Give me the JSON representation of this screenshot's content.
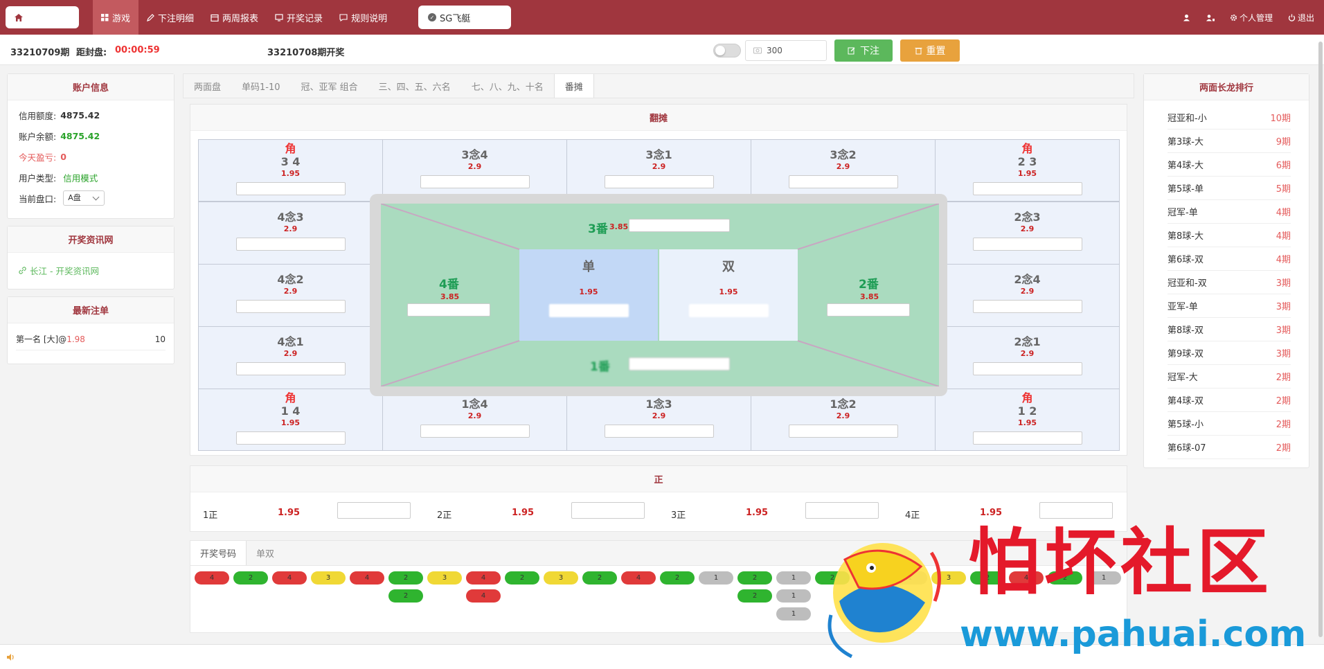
{
  "topbar": {
    "nav": [
      "游戏",
      "下注明细",
      "两周报表",
      "开奖记录",
      "规则说明"
    ],
    "active_game": "SG飞艇",
    "right": [
      "个人管理",
      "退出"
    ]
  },
  "subbar": {
    "period": "33210709期",
    "close_label": "距封盘:",
    "close_time": "00:00:59",
    "last_draw": "33210708期开奖",
    "amount": "300",
    "bet_button": "下注",
    "reset_button": "重置"
  },
  "account": {
    "title": "账户信息",
    "credit_label": "信用额度:",
    "credit_value": "4875.42",
    "balance_label": "账户余额:",
    "balance_value": "4875.42",
    "profit_label": "今天盈亏:",
    "profit_value": "0",
    "type_label": "用户类型:",
    "type_value": "信用模式",
    "market_label": "当前盘口:",
    "market_value": "A盘"
  },
  "info": {
    "title": "开奖资讯网",
    "link": "长江 - 开奖资讯网"
  },
  "recent": {
    "title": "最新注单",
    "bet": "第一名 [大]@",
    "odds": "1.98",
    "amount": "10"
  },
  "tabs": [
    "两面盘",
    "单码1-10",
    "冠、亚军 组合",
    "三、四、五、六名",
    "七、八、九、十名",
    "番摊"
  ],
  "fantan": {
    "title": "翻摊",
    "jiao": "角",
    "corner_tl": "3 4",
    "corner_tr": "2 3",
    "corner_bl": "1 4",
    "corner_br": "1 2",
    "corner_odds": "1.95",
    "nian_odds": "2.9",
    "top": [
      "3念4",
      "3念1",
      "3念2"
    ],
    "bottom": [
      "1念4",
      "1念3",
      "1念2"
    ],
    "left": [
      "4念3",
      "4念2",
      "4念1"
    ],
    "right": [
      "2念3",
      "2念4",
      "2念1"
    ],
    "fan3": "3番",
    "fan4": "4番",
    "fan2": "2番",
    "fan1": "1番",
    "fan_odds": "3.85",
    "dan": "单",
    "shuang": "双",
    "ds_odds": "1.95"
  },
  "zheng": {
    "title": "正",
    "items": [
      {
        "label": "1正",
        "odds": "1.95"
      },
      {
        "label": "2正",
        "odds": "1.95"
      },
      {
        "label": "3正",
        "odds": "1.95"
      },
      {
        "label": "4正",
        "odds": "1.95"
      }
    ]
  },
  "results": {
    "tabs": [
      "开奖号码",
      "单双"
    ],
    "columns": [
      [
        {
          "c": "red",
          "n": "4"
        }
      ],
      [
        {
          "c": "green",
          "n": "2"
        }
      ],
      [
        {
          "c": "red",
          "n": "4"
        }
      ],
      [
        {
          "c": "yellow",
          "n": "3"
        }
      ],
      [
        {
          "c": "red",
          "n": "4"
        }
      ],
      [
        {
          "c": "green",
          "n": "2"
        },
        {
          "c": "green",
          "n": "2"
        }
      ],
      [
        {
          "c": "yellow",
          "n": "3"
        }
      ],
      [
        {
          "c": "red",
          "n": "4"
        },
        {
          "c": "red",
          "n": "4"
        }
      ],
      [
        {
          "c": "green",
          "n": "2"
        }
      ],
      [
        {
          "c": "yellow",
          "n": "3"
        }
      ],
      [
        {
          "c": "green",
          "n": "2"
        }
      ],
      [
        {
          "c": "red",
          "n": "4"
        }
      ],
      [
        {
          "c": "green",
          "n": "2"
        }
      ],
      [
        {
          "c": "gray",
          "n": "1"
        }
      ],
      [
        {
          "c": "green",
          "n": "2"
        },
        {
          "c": "green",
          "n": "2"
        }
      ],
      [
        {
          "c": "gray",
          "n": "1"
        },
        {
          "c": "gray",
          "n": "1"
        },
        {
          "c": "gray",
          "n": "1"
        }
      ],
      [
        {
          "c": "green",
          "n": "2"
        }
      ],
      [
        {
          "c": "red",
          "n": "4"
        }
      ],
      [
        {
          "c": "gray",
          "n": "1"
        }
      ],
      [
        {
          "c": "yellow",
          "n": "3"
        }
      ],
      [
        {
          "c": "green",
          "n": "2"
        }
      ],
      [
        {
          "c": "red",
          "n": "4"
        }
      ],
      [
        {
          "c": "green",
          "n": "2"
        }
      ],
      [
        {
          "c": "gray",
          "n": "1"
        }
      ]
    ]
  },
  "dragon": {
    "title": "两面长龙排行",
    "rows": [
      {
        "name": "冠亚和-小",
        "p": "10期"
      },
      {
        "name": "第3球-大",
        "p": "9期"
      },
      {
        "name": "第4球-大",
        "p": "6期"
      },
      {
        "name": "第5球-单",
        "p": "5期"
      },
      {
        "name": "冠军-单",
        "p": "4期"
      },
      {
        "name": "第8球-大",
        "p": "4期"
      },
      {
        "name": "第6球-双",
        "p": "4期"
      },
      {
        "name": "冠亚和-双",
        "p": "3期"
      },
      {
        "name": "亚军-单",
        "p": "3期"
      },
      {
        "name": "第8球-双",
        "p": "3期"
      },
      {
        "name": "第9球-双",
        "p": "3期"
      },
      {
        "name": "冠军-大",
        "p": "2期"
      },
      {
        "name": "第4球-双",
        "p": "2期"
      },
      {
        "name": "第5球-小",
        "p": "2期"
      },
      {
        "name": "第6球-07",
        "p": "2期"
      }
    ]
  },
  "watermark": {
    "name": "怕坏社区",
    "url": "www.pahuai.com"
  }
}
